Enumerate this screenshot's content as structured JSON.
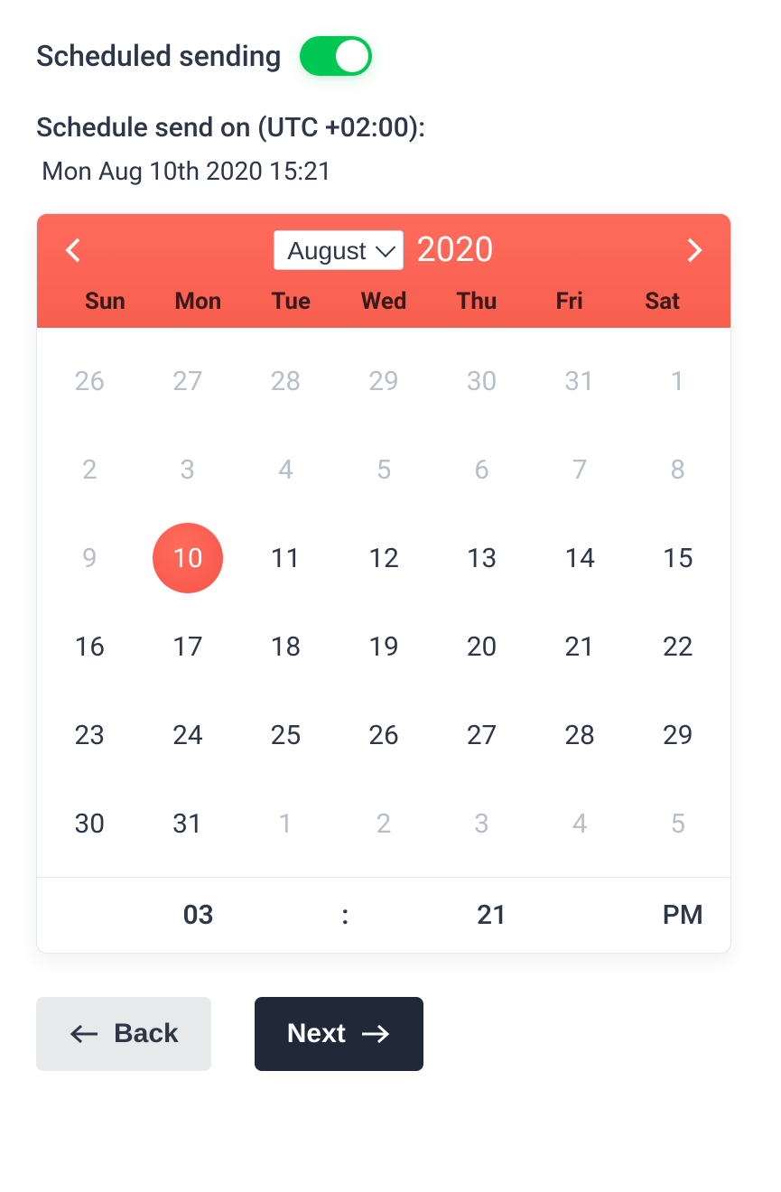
{
  "header": {
    "label": "Scheduled sending",
    "toggle_on": true
  },
  "schedule": {
    "label": "Schedule send on (UTC +02:00):",
    "datetime": "Mon Aug 10th 2020 15:21"
  },
  "calendar": {
    "month": "August",
    "year": "2020",
    "weekdays": [
      "Sun",
      "Mon",
      "Tue",
      "Wed",
      "Thu",
      "Fri",
      "Sat"
    ],
    "days": [
      {
        "n": "26",
        "other": true
      },
      {
        "n": "27",
        "other": true
      },
      {
        "n": "28",
        "other": true
      },
      {
        "n": "29",
        "other": true
      },
      {
        "n": "30",
        "other": true
      },
      {
        "n": "31",
        "other": true
      },
      {
        "n": "1",
        "other": true
      },
      {
        "n": "2",
        "other": true
      },
      {
        "n": "3",
        "other": true
      },
      {
        "n": "4",
        "other": true
      },
      {
        "n": "5",
        "other": true
      },
      {
        "n": "6",
        "other": true
      },
      {
        "n": "7",
        "other": true
      },
      {
        "n": "8",
        "other": true
      },
      {
        "n": "9",
        "other": true
      },
      {
        "n": "10",
        "selected": true
      },
      {
        "n": "11"
      },
      {
        "n": "12"
      },
      {
        "n": "13"
      },
      {
        "n": "14"
      },
      {
        "n": "15"
      },
      {
        "n": "16"
      },
      {
        "n": "17"
      },
      {
        "n": "18"
      },
      {
        "n": "19"
      },
      {
        "n": "20"
      },
      {
        "n": "21"
      },
      {
        "n": "22"
      },
      {
        "n": "23"
      },
      {
        "n": "24"
      },
      {
        "n": "25"
      },
      {
        "n": "26"
      },
      {
        "n": "27"
      },
      {
        "n": "28"
      },
      {
        "n": "29"
      },
      {
        "n": "30"
      },
      {
        "n": "31"
      },
      {
        "n": "1",
        "other": true
      },
      {
        "n": "2",
        "other": true
      },
      {
        "n": "3",
        "other": true
      },
      {
        "n": "4",
        "other": true
      },
      {
        "n": "5",
        "other": true
      }
    ],
    "time": {
      "hour": "03",
      "separator": ":",
      "minute": "21",
      "ampm": "PM"
    }
  },
  "footer": {
    "back": "Back",
    "next": "Next"
  }
}
